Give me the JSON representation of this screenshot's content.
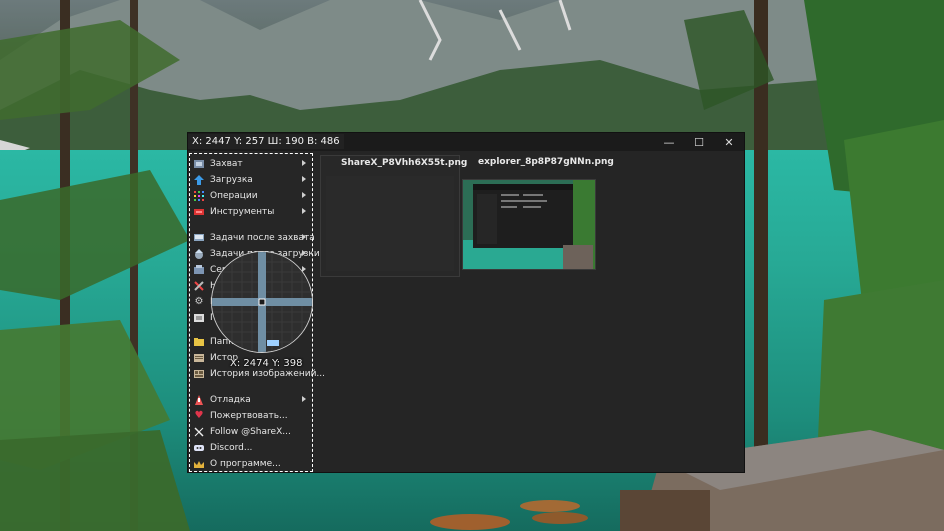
{
  "capture": {
    "region_label": "X: 2447 Y: 257 Ш: 190 В: 486",
    "cursor_label": "X: 2474 Y: 398"
  },
  "window": {
    "controls": {
      "minimize": "—",
      "maximize": "☐",
      "close": "✕"
    },
    "thumbnails": [
      {
        "filename": "ShareX_P8Vhh6X55t.png"
      },
      {
        "filename": "explorer_8p8P87gNNn.png"
      }
    ]
  },
  "menu": {
    "items": [
      {
        "label": "Захват",
        "icon": "capture-icon",
        "submenu": true
      },
      {
        "label": "Загрузка",
        "icon": "upload-icon",
        "submenu": true
      },
      {
        "label": "Операции",
        "icon": "workflows-icon",
        "submenu": true
      },
      {
        "label": "Инструменты",
        "icon": "tools-icon",
        "submenu": true
      },
      {
        "label": "Задачи после захвата",
        "icon": "after-capture-icon",
        "submenu": true
      },
      {
        "label": "Задачи после загрузки",
        "icon": "after-upload-icon",
        "submenu": true
      },
      {
        "label": "Серв",
        "icon": "destinations-icon",
        "submenu": true
      },
      {
        "label": "На",
        "icon": "settings-app-icon",
        "submenu": false
      },
      {
        "label": "Н",
        "icon": "gear-icon",
        "submenu": false
      },
      {
        "label": "Го",
        "icon": "hotkeys-icon",
        "submenu": false
      },
      {
        "label": "Папка",
        "icon": "folder-icon",
        "submenu": false
      },
      {
        "label": "Истор",
        "icon": "history-icon",
        "submenu": false
      },
      {
        "label": "История изображений...",
        "icon": "image-history-icon",
        "submenu": false
      },
      {
        "label": "Отладка",
        "icon": "debug-icon",
        "submenu": true
      },
      {
        "label": "Пожертвовать...",
        "icon": "heart-icon",
        "submenu": false
      },
      {
        "label": "Follow @ShareX...",
        "icon": "x-logo-icon",
        "submenu": false
      },
      {
        "label": "Discord...",
        "icon": "discord-icon",
        "submenu": false
      },
      {
        "label": "О программе...",
        "icon": "crown-icon",
        "submenu": false
      }
    ]
  },
  "colors": {
    "window_bg": "#252525",
    "title_bg": "#1b1b1b",
    "accent_heart": "#e0354b"
  }
}
